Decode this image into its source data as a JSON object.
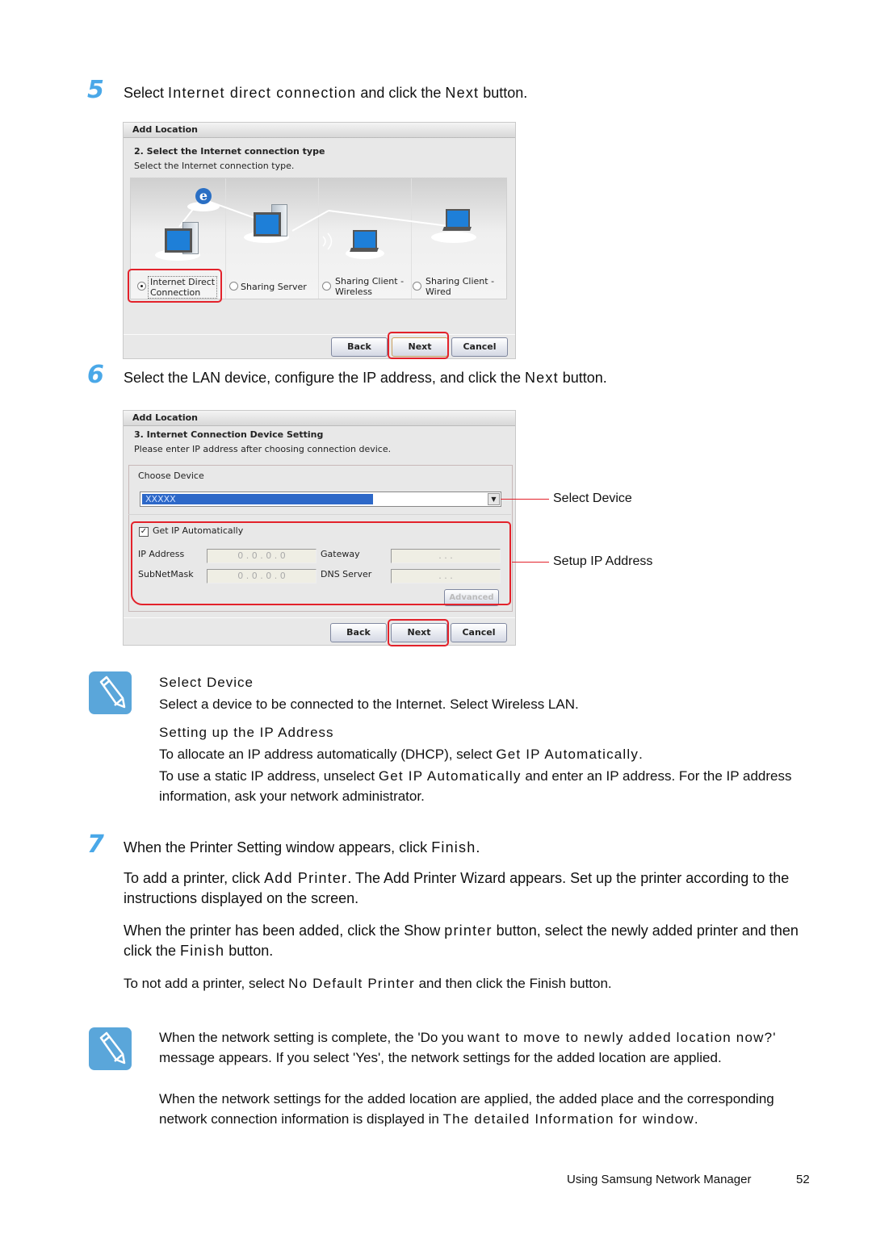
{
  "steps": [
    {
      "number": "5",
      "pre": "Select ",
      "mono": "Internet direct connection",
      "post": " and click the ",
      "mono2": "Next",
      "post2": " button."
    },
    {
      "number": "6",
      "pre": "Select the LAN device, configure the IP address, and click the ",
      "mono": "Next",
      "post": " button."
    },
    {
      "number": "7",
      "pre": "When the Printer Setting window appears, click ",
      "mono": "Finish",
      "post": "."
    }
  ],
  "dialog1": {
    "title": "Add Location",
    "heading": "2. Select the Internet connection type",
    "subheading": "Select the Internet connection type.",
    "options": [
      {
        "label_line1": "Internet Direct",
        "label_line2": "Connection",
        "selected": true
      },
      {
        "label_line1": "Sharing Server",
        "label_line2": "",
        "selected": false
      },
      {
        "label_line1": "Sharing Client -",
        "label_line2": "Wireless",
        "selected": false
      },
      {
        "label_line1": "Sharing Client -",
        "label_line2": "Wired",
        "selected": false
      }
    ],
    "buttons": {
      "back": "Back",
      "next": "Next",
      "cancel": "Cancel"
    }
  },
  "dialog2": {
    "title": "Add Location",
    "heading": "3. Internet Connection Device Setting",
    "subheading": "Please enter IP address after choosing connection device.",
    "choose_device_label": "Choose Device",
    "device_value": "XXXXX",
    "get_ip_auto_label": "Get IP Automatically",
    "get_ip_auto_checked": true,
    "ip_label": "IP Address",
    "ip_value": "0 . 0 . 0 . 0",
    "subnet_label": "SubNetMask",
    "subnet_value": "0 . 0 . 0 . 0",
    "gateway_label": "Gateway",
    "gateway_value": ".   .   .",
    "dns_label": "DNS Server",
    "dns_value": ".   .   .",
    "advanced_label": "Advanced",
    "buttons": {
      "back": "Back",
      "next": "Next",
      "cancel": "Cancel"
    }
  },
  "callouts": {
    "select_device": "Select Device",
    "setup_ip": "Setup IP Address"
  },
  "note1": {
    "title1": "Select Device",
    "text1": "Select a device to be connected to the Internet. Select Wireless LAN.",
    "title2": "Setting up the IP Address",
    "text2_pre": "To allocate an IP address automatically (DHCP), select ",
    "text2_mono": "Get IP Automatically",
    "text2_post": ".",
    "text3_pre": "To use a static IP address, unselect ",
    "text3_mono": "Get IP Automatically",
    "text3_post": " and enter an IP address. For the IP address information, ask your network administrator."
  },
  "step7_paras": {
    "p1_pre": "To add a printer, click ",
    "p1_mono": "Add Printer",
    "p1_post": ". The Add Printer Wizard appears. Set up the printer according to the instructions displayed on the screen.",
    "p2_pre": "When the printer has been added, click the Show ",
    "p2_mono": "printer",
    "p2_post": " button, select the newly added printer and then click the ",
    "p2_mono2": "Finish",
    "p2_post2": " button.",
    "p3_pre": "To not add a printer, select  ",
    "p3_mono": "No Default Printer",
    "p3_post": " and then click the Finish button."
  },
  "note2": {
    "p1_pre": "When the network setting is complete, the 'Do you ",
    "p1_mono": "want to move to newly added location now?",
    "p1_post": "' message appears. If you select 'Yes', the network settings for the added location are applied.",
    "p2_pre": "When the network settings for the added location are applied, the added place and the corresponding network connection information is displayed in ",
    "p2_mono": "The detailed Information for window",
    "p2_post": "."
  },
  "footer": {
    "section": "Using Samsung Network Manager",
    "page": "52"
  }
}
